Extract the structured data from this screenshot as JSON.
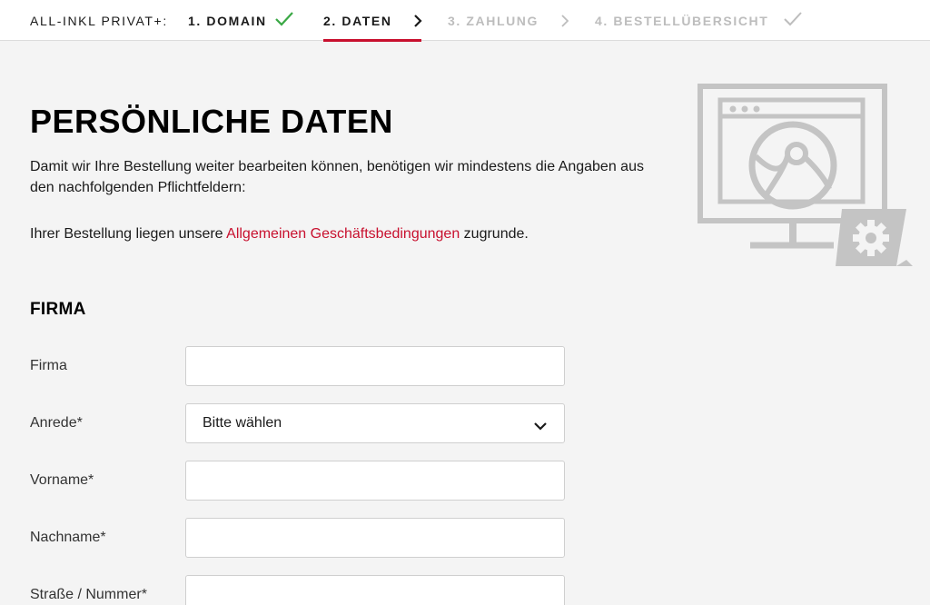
{
  "header": {
    "brand": "ALL-INKL PRIVAT+:",
    "steps": [
      {
        "label": "1. DOMAIN",
        "state": "done"
      },
      {
        "label": "2. DATEN",
        "state": "active"
      },
      {
        "label": "3. ZAHLUNG",
        "state": "pending"
      },
      {
        "label": "4. BESTELLÜBERSICHT",
        "state": "pending"
      }
    ]
  },
  "main": {
    "title": "PERSÖNLICHE DATEN",
    "intro": "Damit wir Ihre Bestellung weiter bearbeiten können, benötigen wir mindestens die Angaben aus den nachfolgenden Pflichtfeldern:",
    "terms_prefix": "Ihrer Bestellung liegen unsere",
    "terms_link": "Allgemeinen Geschäftsbedingungen",
    "terms_suffix": "zugrunde."
  },
  "form": {
    "section_title": "FIRMA",
    "fields": [
      {
        "label": "Firma",
        "value": ""
      },
      {
        "label": "Anrede*",
        "value": "Bitte wählen"
      },
      {
        "label": "Vorname*",
        "value": ""
      },
      {
        "label": "Nachname*",
        "value": ""
      },
      {
        "label": "Straße / Nummer*",
        "value": ""
      }
    ]
  },
  "colors": {
    "accent": "#c8102e",
    "check_done": "#3aa845",
    "pending": "#bdbdbd",
    "illustration": "#c4c4c4"
  },
  "icons": [
    "check-icon",
    "chevron-right-icon",
    "chevron-down-icon",
    "monitor-globe-icon",
    "gear-icon"
  ]
}
